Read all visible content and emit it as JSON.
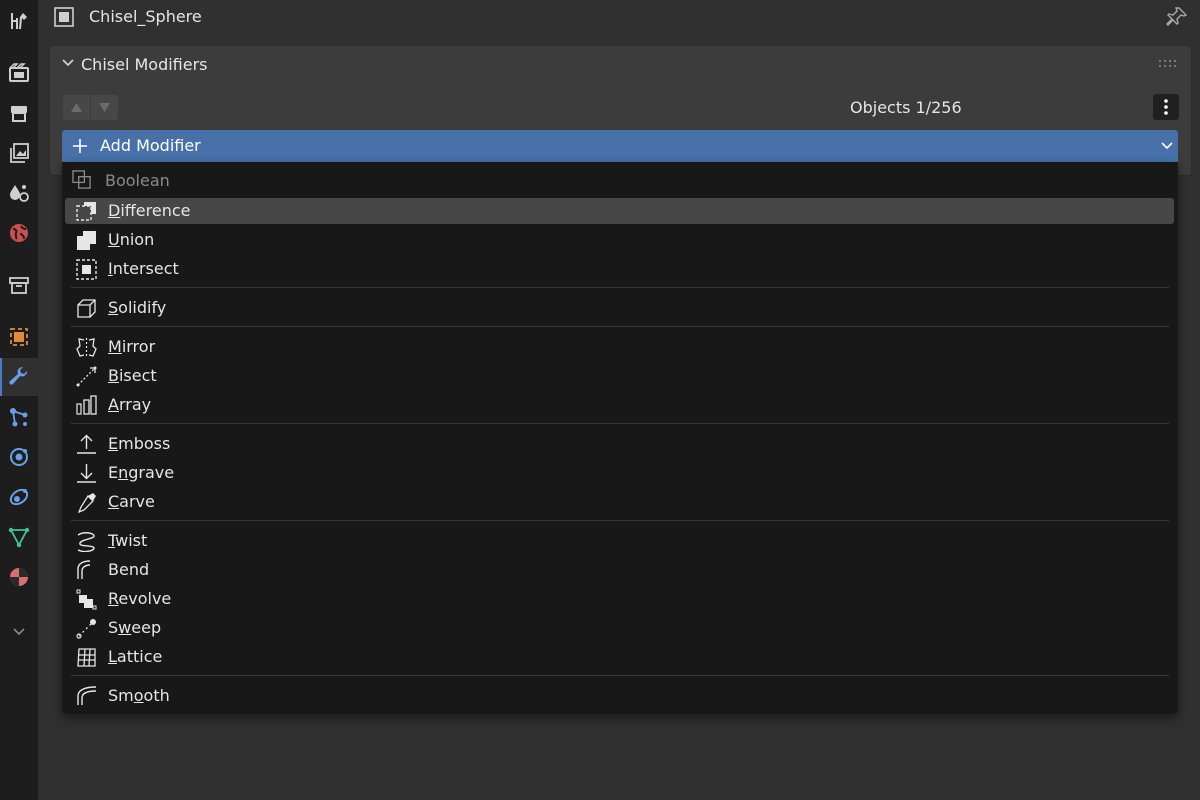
{
  "header": {
    "object_name": "Chisel_Sphere",
    "object_icon": "object-icon",
    "pin_icon": "pin-icon"
  },
  "sidebar": {
    "tabs": [
      {
        "name": "tool-icon"
      },
      {
        "name": "render-icon"
      },
      {
        "name": "output-icon"
      },
      {
        "name": "view-layer-icon"
      },
      {
        "name": "scene-icon"
      },
      {
        "name": "world-icon"
      },
      {
        "name": "collection-icon"
      },
      {
        "name": "object-icon"
      },
      {
        "name": "modifier-icon",
        "active": true
      },
      {
        "name": "particles-icon"
      },
      {
        "name": "physics-icon"
      },
      {
        "name": "constraints-icon"
      },
      {
        "name": "data-icon"
      },
      {
        "name": "material-icon"
      },
      {
        "name": "collapse-chevron-icon"
      }
    ]
  },
  "panel": {
    "title": "Chisel Modifiers",
    "objects_count": "Objects 1/256"
  },
  "add_modifier": {
    "label": "Add Modifier"
  },
  "menu": {
    "header": "Boolean",
    "items": [
      {
        "key": "difference",
        "label": "Difference",
        "mnemonic": "D",
        "icon": "boolean-difference-icon",
        "highlighted": true
      },
      {
        "key": "union",
        "label": "Union",
        "mnemonic": "U",
        "icon": "boolean-union-icon"
      },
      {
        "key": "intersect",
        "label": "Intersect",
        "mnemonic": "I",
        "icon": "boolean-intersect-icon"
      },
      {
        "key": "solidify",
        "label": "Solidify",
        "mnemonic": "S",
        "icon": "solidify-icon"
      },
      {
        "key": "mirror",
        "label": "Mirror",
        "mnemonic": "M",
        "icon": "mirror-icon"
      },
      {
        "key": "bisect",
        "label": "Bisect",
        "mnemonic": "B",
        "icon": "bisect-icon"
      },
      {
        "key": "array",
        "label": "Array",
        "mnemonic": "A",
        "icon": "array-icon"
      },
      {
        "key": "emboss",
        "label": "Emboss",
        "mnemonic": "E",
        "icon": "emboss-icon"
      },
      {
        "key": "engrave",
        "label": "Engrave",
        "mnemonic": "n",
        "icon": "engrave-icon"
      },
      {
        "key": "carve",
        "label": "Carve",
        "mnemonic": "C",
        "icon": "carve-icon"
      },
      {
        "key": "twist",
        "label": "Twist",
        "mnemonic": "T",
        "icon": "twist-icon"
      },
      {
        "key": "bend",
        "label": "Bend",
        "mnemonic": "",
        "icon": "bend-icon"
      },
      {
        "key": "revolve",
        "label": "Revolve",
        "mnemonic": "R",
        "icon": "revolve-icon"
      },
      {
        "key": "sweep",
        "label": "Sweep",
        "mnemonic": "w",
        "icon": "sweep-icon"
      },
      {
        "key": "lattice",
        "label": "Lattice",
        "mnemonic": "L",
        "icon": "lattice-icon"
      },
      {
        "key": "smooth",
        "label": "Smooth",
        "mnemonic": "o",
        "icon": "smooth-icon"
      }
    ]
  },
  "colors": {
    "accent": "#4771a8",
    "menu_background": "#181818",
    "highlight": "#474747"
  }
}
